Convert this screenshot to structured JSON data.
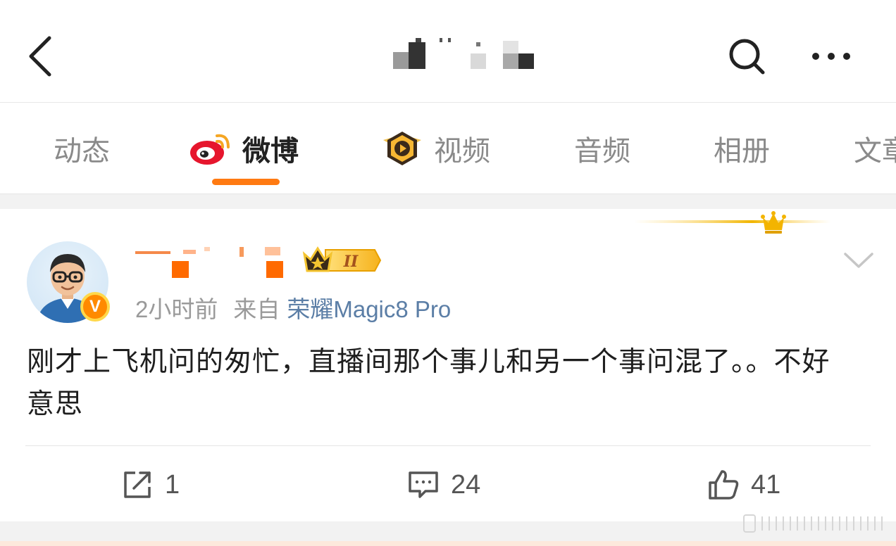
{
  "header": {
    "back_icon": "back-arrow-icon",
    "search_icon": "search-icon",
    "more_icon": "more-dots-icon"
  },
  "tabs": [
    {
      "label": "动态",
      "icon": null,
      "active": false
    },
    {
      "label": "微博",
      "icon": "weibo-logo-icon",
      "active": true
    },
    {
      "label": "视频",
      "icon": "video-badge-icon",
      "active": false
    },
    {
      "label": "音频",
      "icon": null,
      "active": false
    },
    {
      "label": "相册",
      "icon": null,
      "active": false
    },
    {
      "label": "文章",
      "icon": null,
      "active": false
    }
  ],
  "post": {
    "verified_badge": "V",
    "level_badge": "II",
    "time": "2小时前",
    "from_label": "来自",
    "source": "荣耀Magic8 Pro",
    "text": "刚才上飞机问的匆忙，直播间那个事儿和另一个事问混了。。不好意思",
    "actions": {
      "repost_count": "1",
      "comment_count": "24",
      "like_count": "41"
    }
  },
  "colors": {
    "accent": "#ff7a12",
    "link": "#5b7ea6",
    "muted": "#9a9a9a",
    "background_band": "#f2f2f2"
  }
}
